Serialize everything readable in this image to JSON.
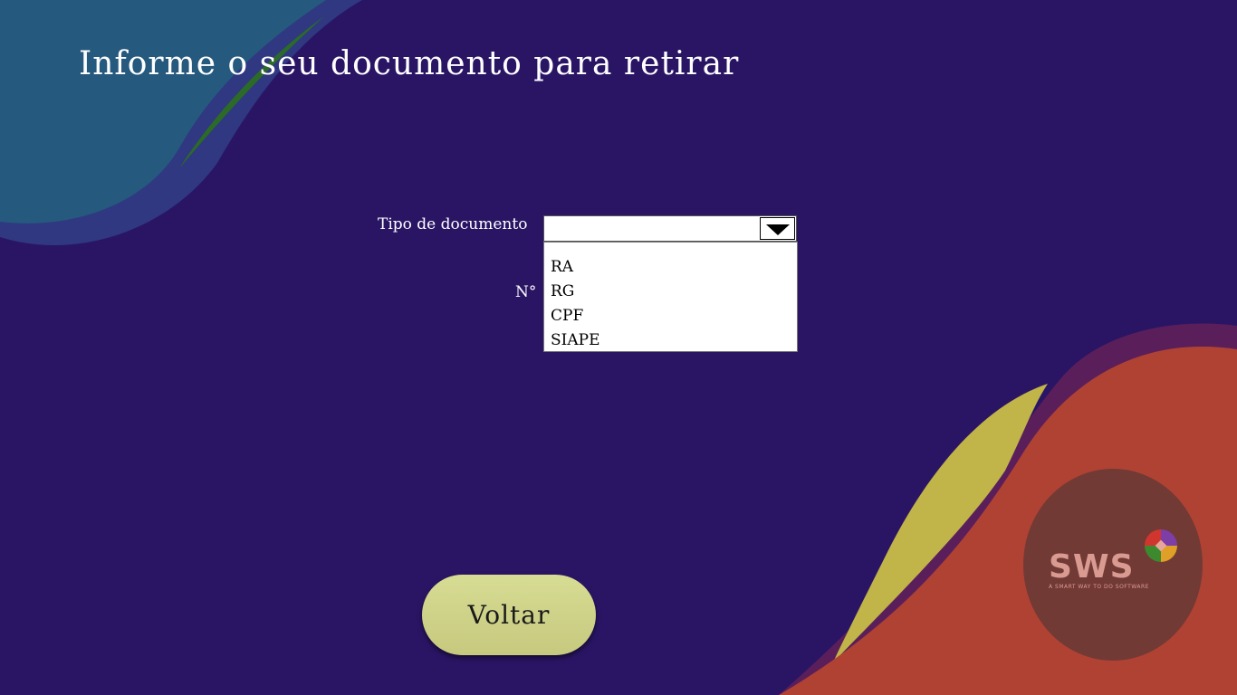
{
  "header": {
    "title": "Informe o seu documento para retirar"
  },
  "form": {
    "document_type_label": "Tipo de documento",
    "document_type_value": "",
    "document_type_options": [
      "RA",
      "RG",
      "CPF",
      "SIAPE"
    ],
    "number_label": "N°"
  },
  "actions": {
    "back_label": "Voltar"
  },
  "brand": {
    "logo_text": "SWS",
    "tagline": "A SMART WAY TO DO SOFTWARE"
  },
  "colors": {
    "background": "#2a1565",
    "accent_button": "#c8cc80",
    "wave_teal": "#26597e",
    "wave_green": "#2c6b27",
    "wave_yellow": "#c1b448",
    "wave_orange": "#b04233",
    "wave_purple": "#5a1f5a"
  }
}
